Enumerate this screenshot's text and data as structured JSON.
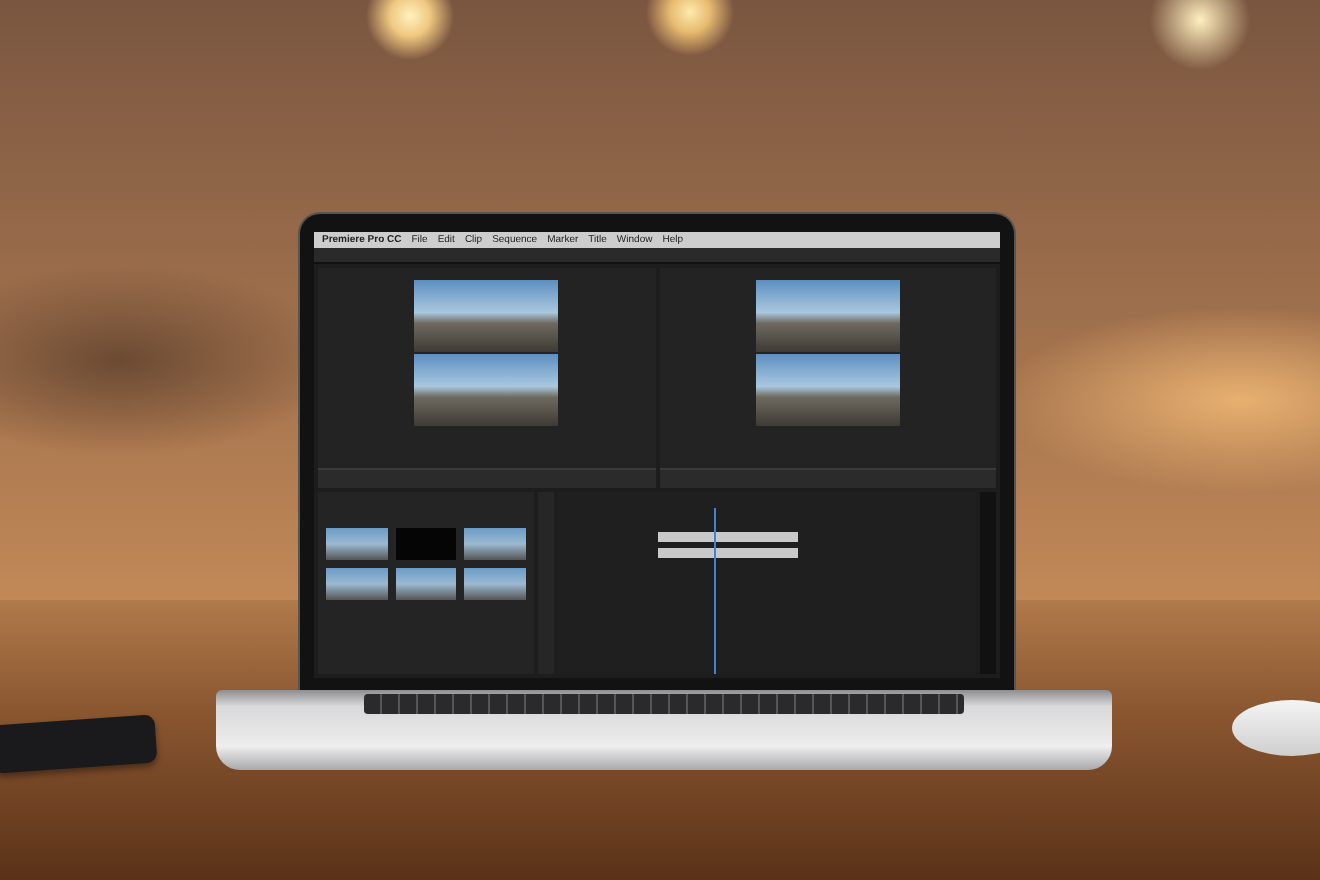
{
  "scene": {
    "kind": "laptop-on-desk"
  },
  "menu_bar": {
    "app_name": "Premiere Pro CC",
    "items": [
      "File",
      "Edit",
      "Clip",
      "Sequence",
      "Marker",
      "Title",
      "Window",
      "Help"
    ]
  }
}
